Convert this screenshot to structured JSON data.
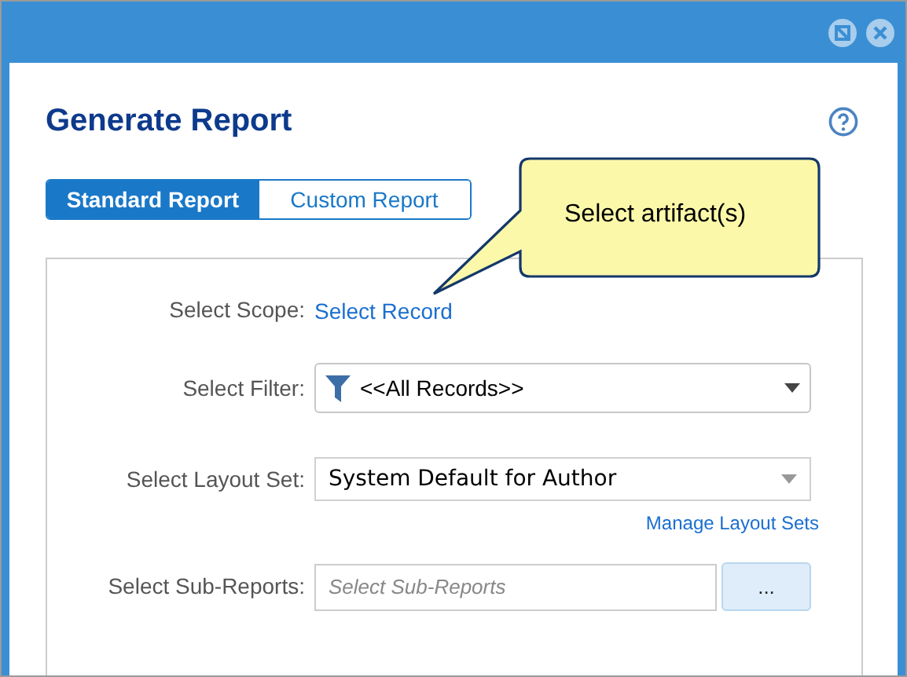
{
  "window": {
    "title": "Generate Report"
  },
  "tabs": [
    {
      "label": "Standard Report",
      "selected": true
    },
    {
      "label": "Custom Report",
      "selected": false
    }
  ],
  "callout": {
    "text": "Select artifact(s)"
  },
  "form": {
    "scope": {
      "label": "Select Scope:",
      "link": "Select Record"
    },
    "filter": {
      "label": "Select Filter:",
      "value": "<<All Records>>"
    },
    "layout_set": {
      "label": "Select Layout Set:",
      "value": "System Default for Author",
      "link": "Manage Layout Sets"
    },
    "sub_reports": {
      "label": "Select Sub-Reports:",
      "placeholder": "Select Sub-Reports",
      "button": "..."
    }
  }
}
